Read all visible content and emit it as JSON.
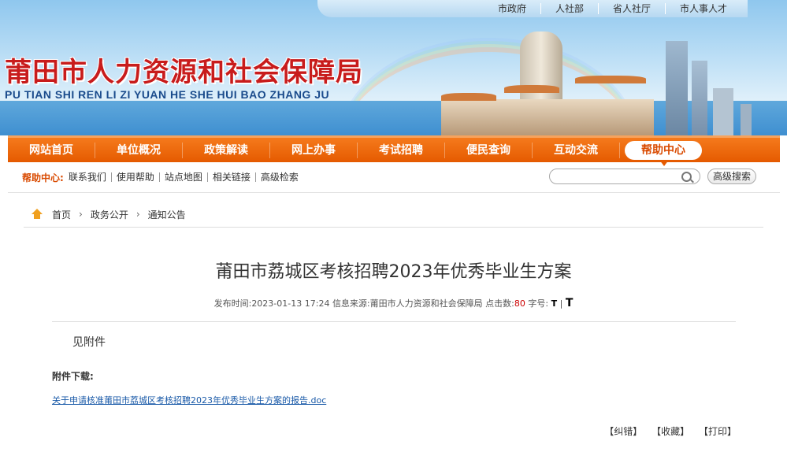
{
  "top_links": [
    "市政府",
    "人社部",
    "省人社厅",
    "市人事人才"
  ],
  "logo": {
    "cn": "莆田市人力资源和社会保障局",
    "en": "PU TIAN SHI REN LI ZI YUAN HE SHE HUI BAO ZHANG JU"
  },
  "main_nav": [
    {
      "label": "网站首页"
    },
    {
      "label": "单位概况"
    },
    {
      "label": "政策解读"
    },
    {
      "label": "网上办事"
    },
    {
      "label": "考试招聘"
    },
    {
      "label": "便民查询"
    },
    {
      "label": "互动交流"
    },
    {
      "label": "帮助中心",
      "active": true
    }
  ],
  "sub_nav": {
    "label": "帮助中心:",
    "links": [
      "联系我们",
      "使用帮助",
      "站点地图",
      "相关链接",
      "高级检索"
    ]
  },
  "search": {
    "placeholder": "",
    "advanced_label": "高级搜索"
  },
  "breadcrumb": [
    "首页",
    "政务公开",
    "通知公告"
  ],
  "article": {
    "title": "莆田市荔城区考核招聘2023年优秀毕业生方案",
    "publish_label": "发布时间:",
    "publish_time": "2023-01-13 17:24",
    "source_label": "信息来源:",
    "source": "莆田市人力资源和社会保障局",
    "hits_label": "点击数:",
    "hits": "80",
    "font_label": "字号:",
    "font_small": "T",
    "font_large": "T",
    "body": "见附件",
    "attachment_label": "附件下载:",
    "attachment_link": "关于申请核准莆田市荔城区考核招聘2023年优秀毕业生方案的报告.doc"
  },
  "actions": [
    "【纠错】",
    "【收藏】",
    "【打印】"
  ],
  "colors": {
    "nav_orange": "#e55a00",
    "logo_red": "#c81c1c",
    "logo_blue": "#1a4b8c",
    "link_blue": "#1a5aa8"
  }
}
